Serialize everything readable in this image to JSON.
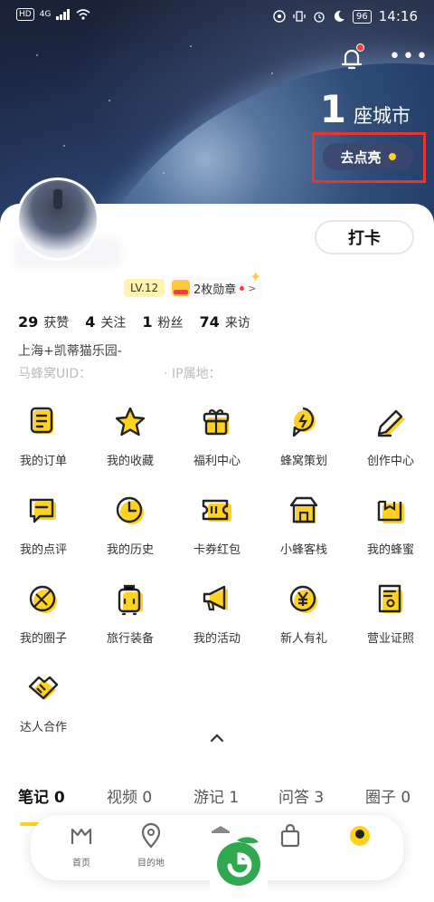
{
  "status_bar": {
    "left_chip": "HD",
    "network": "4G",
    "battery": "96",
    "time": "14:16"
  },
  "header": {
    "city_count": "1",
    "city_label": "座城市",
    "light_up_label": "去点亮"
  },
  "profile": {
    "checkin_label": "打卡",
    "level": "LV.12",
    "medals": "2枚勋章",
    "stats": [
      {
        "value": "29",
        "label": "获赞"
      },
      {
        "value": "4",
        "label": "关注"
      },
      {
        "value": "1",
        "label": "粉丝"
      },
      {
        "value": "74",
        "label": "来访"
      }
    ],
    "location": "上海+凯蒂猫乐园-",
    "uid_label": "马蜂窝UID：",
    "ip_label": "· IP属地："
  },
  "grid": [
    {
      "label": "我的订单",
      "icon": "order-icon"
    },
    {
      "label": "我的收藏",
      "icon": "star-icon"
    },
    {
      "label": "福利中心",
      "icon": "gift-icon"
    },
    {
      "label": "蜂窝策划",
      "icon": "planning-icon"
    },
    {
      "label": "创作中心",
      "icon": "pen-icon"
    },
    {
      "label": "我的点评",
      "icon": "review-icon"
    },
    {
      "label": "我的历史",
      "icon": "clock-icon"
    },
    {
      "label": "卡券红包",
      "icon": "coupon-icon"
    },
    {
      "label": "小蜂客栈",
      "icon": "inn-icon"
    },
    {
      "label": "我的蜂蜜",
      "icon": "honey-icon"
    },
    {
      "label": "我的圈子",
      "icon": "circle-icon"
    },
    {
      "label": "旅行装备",
      "icon": "luggage-icon"
    },
    {
      "label": "我的活动",
      "icon": "megaphone-icon"
    },
    {
      "label": "新人有礼",
      "icon": "yen-coin-icon"
    },
    {
      "label": "营业证照",
      "icon": "license-icon"
    },
    {
      "label": "达人合作",
      "icon": "handshake-icon"
    }
  ],
  "tabs": [
    {
      "label": "笔记 0"
    },
    {
      "label": "视频 0"
    },
    {
      "label": "游记 1"
    },
    {
      "label": "问答 3"
    },
    {
      "label": "圈子 0"
    }
  ],
  "bottom_nav": [
    {
      "label": "首页",
      "icon": "home-icon"
    },
    {
      "label": "目的地",
      "icon": "location-pin-icon"
    },
    {
      "label": "",
      "icon": "cube-icon"
    },
    {
      "label": "",
      "icon": "bag-icon"
    },
    {
      "label": "",
      "icon": "profile-icon"
    }
  ],
  "colors": {
    "accent_yellow": "#ffd21f",
    "highlight_red": "#e8352d",
    "notification_red": "#ff3b30"
  }
}
